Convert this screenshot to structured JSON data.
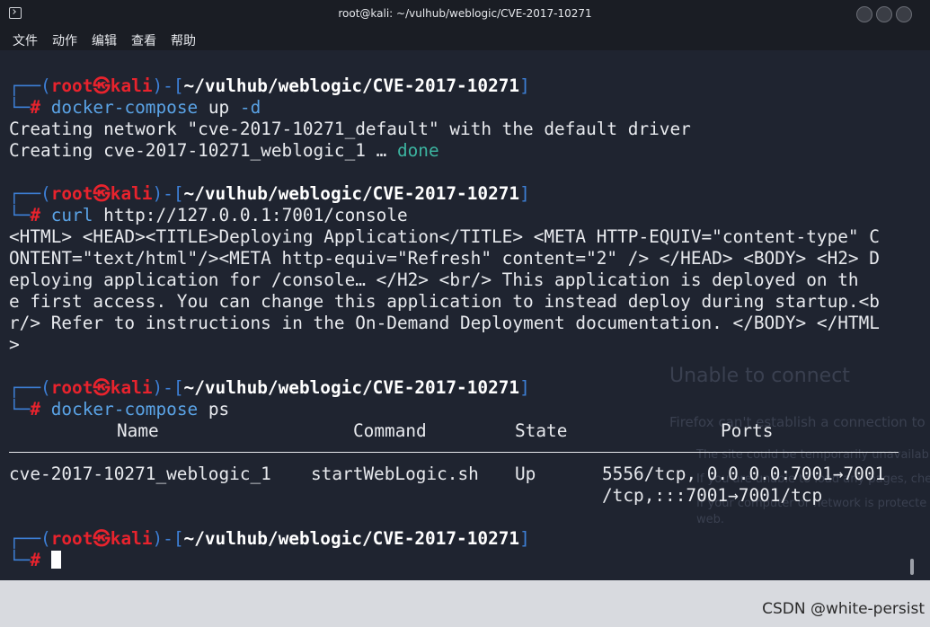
{
  "window": {
    "title": "root@kali: ~/vulhub/weblogic/CVE-2017-10271"
  },
  "menu": {
    "file": "文件",
    "action": "动作",
    "edit": "编辑",
    "view": "查看",
    "help": "帮助"
  },
  "prompt": {
    "open_bracket": "┌──(",
    "user": "root",
    "at": "㉿",
    "host": "kali",
    "mid": ")-[",
    "path": "~/vulhub/weblogic/CVE-2017-10271",
    "close": "]",
    "second_line_prefix": "└─",
    "hash": "#"
  },
  "commands": {
    "c1_name": "docker-compose",
    "c1_args": " up ",
    "c1_flag": "-d",
    "c2_name": "curl",
    "c2_args": " http://127.0.0.1:7001/console",
    "c3_name": "docker-compose",
    "c3_args": " ps"
  },
  "output": {
    "o1_line1": "Creating network \"cve-2017-10271_default\" with the default driver",
    "o1_line2": "Creating cve-2017-10271_weblogic_1 … ",
    "o1_done": "done",
    "html_lines": [
      "<HTML> <HEAD><TITLE>Deploying Application</TITLE> <META HTTP-EQUIV=\"content-type\" C",
      "ONTENT=\"text/html\"/><META http-equiv=\"Refresh\" content=\"2\" /> </HEAD> <BODY> <H2> D",
      "eploying application for /console… </H2> <br/> This application is deployed on th",
      "e first access. You can change this application to instead deploy during startup.<b",
      "r/> Refer to instructions in the On-Demand Deployment documentation. </BODY> </HTML",
      ">"
    ]
  },
  "ps_table": {
    "headers": [
      "Name",
      "Command",
      "State",
      "Ports"
    ],
    "row": {
      "name": "cve-2017-10271_weblogic_1",
      "command": "startWebLogic.sh",
      "state": "Up",
      "ports_line1": "5556/tcp, 0.0.0.0:7001→7001",
      "ports_line2": "/tcp,:::7001→7001/tcp"
    }
  },
  "background_ghost": {
    "heading": "Unable to connect",
    "line1": "Firefox can't establish a connection to",
    "bullet1": "The site could be temporarily unavailab",
    "bullet2": "If you are unable to load any pages, che",
    "bullet3": "If your computer or network is protecte",
    "bullet3b": "web."
  },
  "watermark": "CSDN @white-persist"
}
